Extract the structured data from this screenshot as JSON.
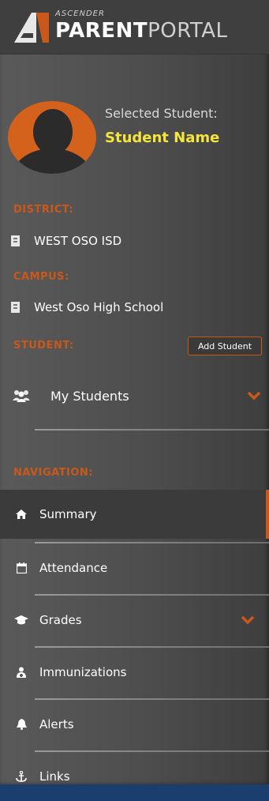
{
  "brand": {
    "small": "ASCENDER",
    "main_bold": "PARENT",
    "main_light": "PORTAL"
  },
  "student": {
    "selected_label": "Selected Student:",
    "name": "Student Name"
  },
  "district": {
    "heading": "DISTRICT:",
    "value": "WEST OSO ISD"
  },
  "campus": {
    "heading": "CAMPUS:",
    "value": "West Oso High School"
  },
  "student_section": {
    "heading": "STUDENT:",
    "add_label": "Add Student",
    "my_students_label": "My Students"
  },
  "navigation": {
    "heading": "NAVIGATION:",
    "items": [
      {
        "label": "Summary",
        "icon": "home-icon",
        "active": true
      },
      {
        "label": "Attendance",
        "icon": "calendar-icon"
      },
      {
        "label": "Grades",
        "icon": "graduation-cap-icon",
        "expandable": true
      },
      {
        "label": "Immunizations",
        "icon": "medic-icon"
      },
      {
        "label": "Alerts",
        "icon": "bell-icon"
      },
      {
        "label": "Links",
        "icon": "anchor-icon"
      }
    ]
  },
  "colors": {
    "accent": "#c9581a",
    "highlight_name": "#f6e53a",
    "sidebar": "#4d4d4d"
  }
}
